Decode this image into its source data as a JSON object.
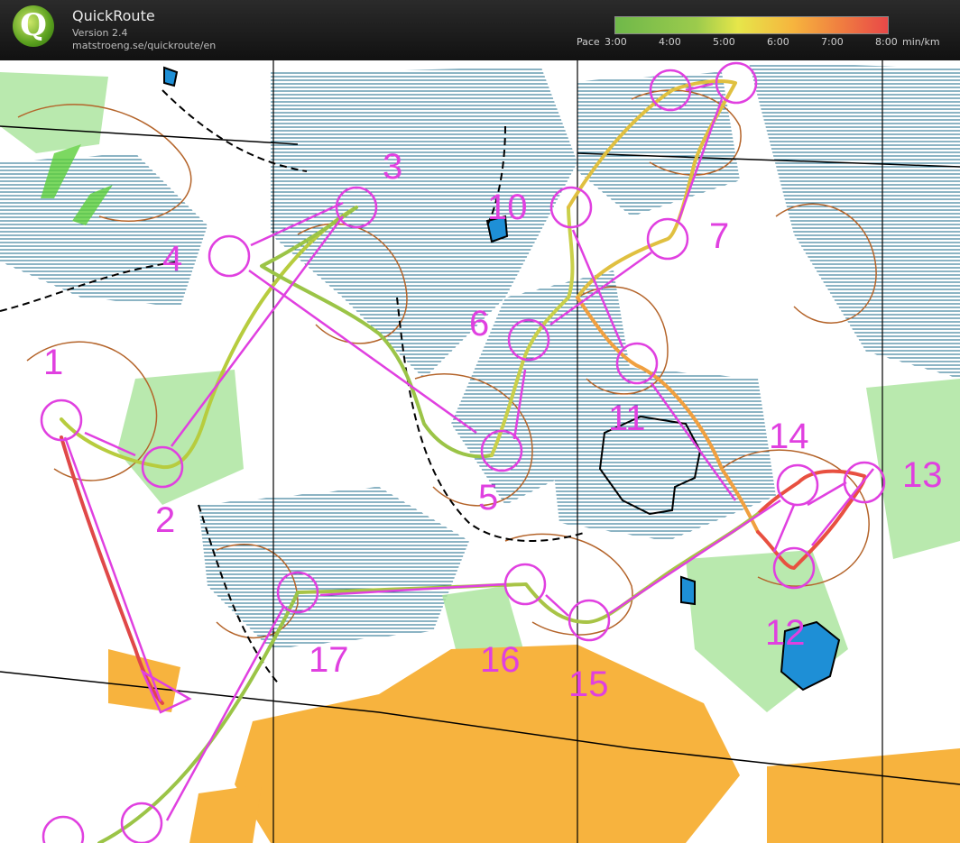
{
  "app": {
    "title": "QuickRoute",
    "version": "Version 2.4",
    "url": "matstroeng.se/quickroute/en"
  },
  "pace_scale": {
    "prefix": "Pace",
    "ticks": [
      "3:00",
      "4:00",
      "5:00",
      "6:00",
      "7:00",
      "8:00"
    ],
    "unit": "min/km",
    "colors": {
      "fast": "#6fb84a",
      "medium": "#e6e64a",
      "slow": "#e84848"
    }
  },
  "map": {
    "controls": [
      "1",
      "2",
      "3",
      "4",
      "5",
      "6",
      "7",
      "10",
      "11",
      "12",
      "13",
      "14",
      "15",
      "16",
      "17"
    ],
    "colors": {
      "course": "#e040e0",
      "water": "#1e8fd6",
      "open_land": "#f7b33e",
      "forest_green": "#7ad26a",
      "contour": "#b4642a",
      "marsh": "#1a6a8a"
    }
  }
}
